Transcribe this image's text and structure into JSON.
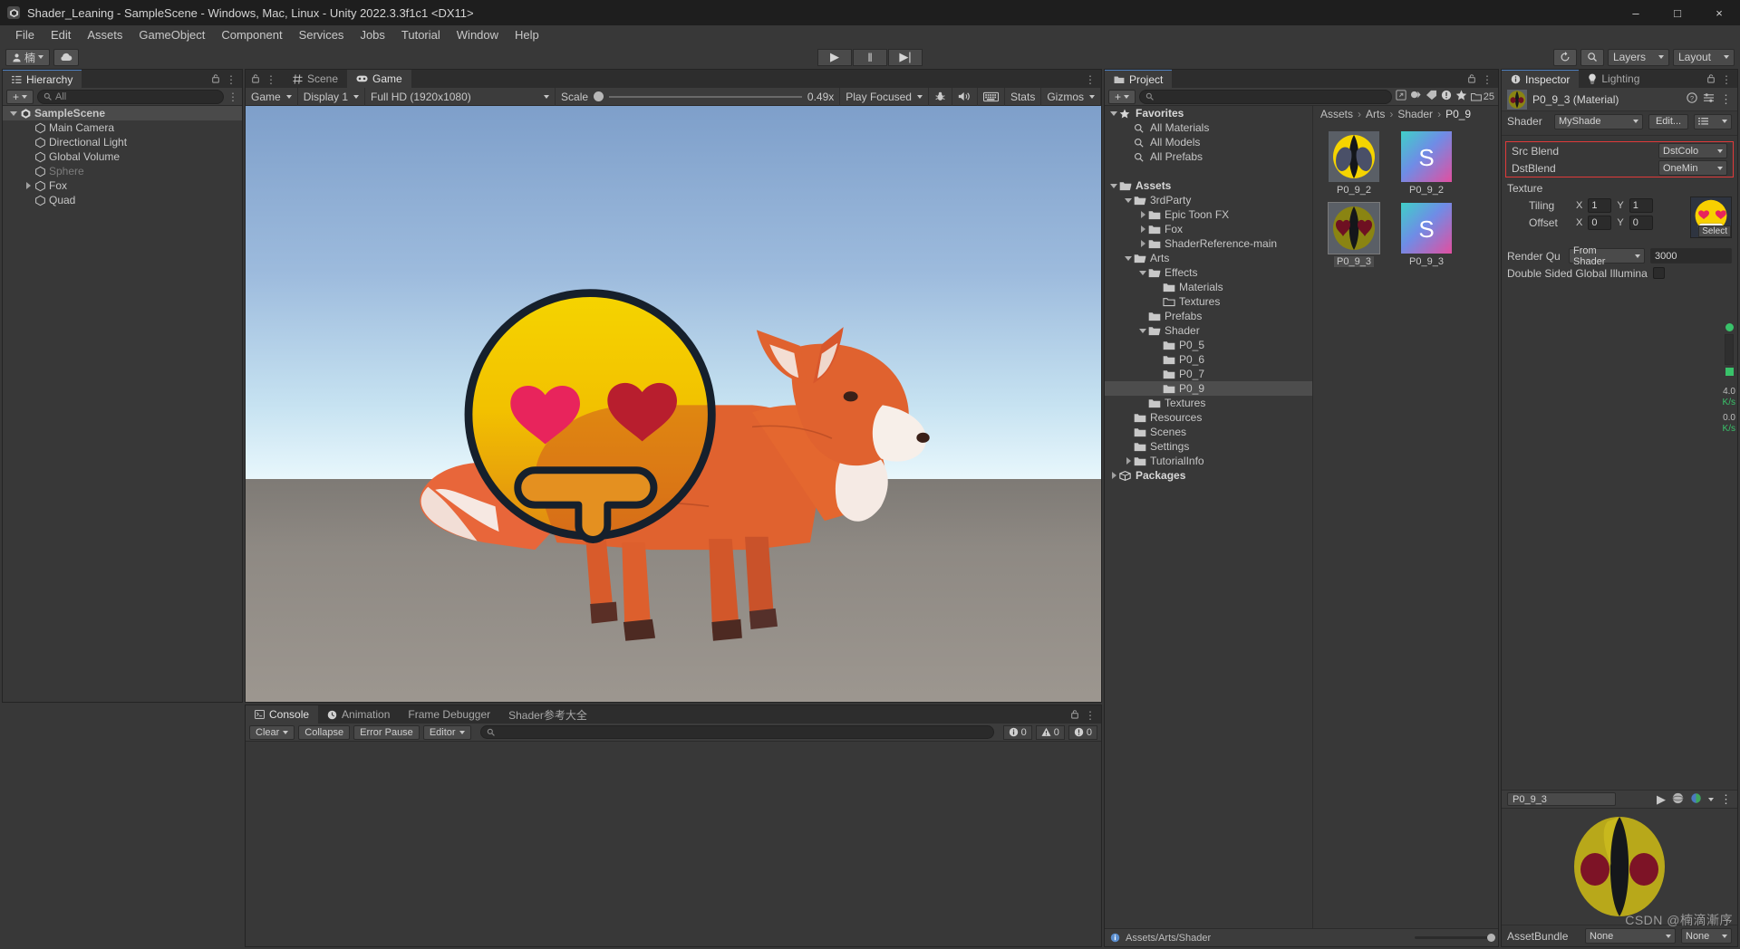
{
  "window": {
    "title": "Shader_Leaning - SampleScene - Windows, Mac, Linux - Unity 2022.3.3f1c1 <DX11>",
    "minimize": "–",
    "maximize": "□",
    "close": "×"
  },
  "menu": {
    "items": [
      "File",
      "Edit",
      "Assets",
      "GameObject",
      "Component",
      "Services",
      "Jobs",
      "Tutorial",
      "Window",
      "Help"
    ]
  },
  "toolbar": {
    "account_label": "楠",
    "cloud_icon": "cloud-icon",
    "play": "▶",
    "pause": "‖",
    "step": "▶|",
    "undo_icon": "history-icon",
    "search_icon": "search-icon",
    "layers": "Layers",
    "layout": "Layout"
  },
  "hierarchy": {
    "tab": "Hierarchy",
    "add_label": "+",
    "search_placeholder": "All",
    "items": [
      {
        "label": "SampleScene",
        "depth": 0,
        "arrow": "down",
        "selected": true,
        "dim": false,
        "icon": "scene-icon"
      },
      {
        "label": "Main Camera",
        "depth": 1,
        "arrow": "none",
        "selected": false,
        "dim": false,
        "icon": "gameobject-icon"
      },
      {
        "label": "Directional Light",
        "depth": 1,
        "arrow": "none",
        "selected": false,
        "dim": false,
        "icon": "gameobject-icon"
      },
      {
        "label": "Global Volume",
        "depth": 1,
        "arrow": "none",
        "selected": false,
        "dim": false,
        "icon": "gameobject-icon"
      },
      {
        "label": "Sphere",
        "depth": 1,
        "arrow": "none",
        "selected": false,
        "dim": true,
        "icon": "gameobject-icon"
      },
      {
        "label": "Fox",
        "depth": 1,
        "arrow": "right",
        "selected": false,
        "dim": false,
        "icon": "gameobject-icon"
      },
      {
        "label": "Quad",
        "depth": 1,
        "arrow": "none",
        "selected": false,
        "dim": false,
        "icon": "gameobject-icon"
      }
    ]
  },
  "gameview": {
    "tabs": [
      {
        "label": "Scene",
        "icon": "grid-icon",
        "active": false
      },
      {
        "label": "Game",
        "icon": "gamepad-icon",
        "active": true
      }
    ],
    "mode": "Game",
    "display": "Display 1",
    "resolution": "Full HD (1920x1080)",
    "scale_label": "Scale",
    "scale_value": "0.49x",
    "play_focus": "Play Focused",
    "mute_icon": "speaker-icon",
    "stats": "Stats",
    "gizmos": "Gizmos",
    "bug_icon": "bug-icon",
    "keyboard_icon": "keyboard-icon"
  },
  "project": {
    "tab": "Project",
    "search_placeholder": "",
    "count_badge": "25",
    "breadcrumb": [
      "Assets",
      "Arts",
      "Shader",
      "P0_9"
    ],
    "tree": [
      {
        "label": "Favorites",
        "depth": 0,
        "arrow": "down",
        "icon": "star",
        "bold": true
      },
      {
        "label": "All Materials",
        "depth": 1,
        "arrow": "none",
        "icon": "search",
        "bold": false
      },
      {
        "label": "All Models",
        "depth": 1,
        "arrow": "none",
        "icon": "search",
        "bold": false
      },
      {
        "label": "All Prefabs",
        "depth": 1,
        "arrow": "none",
        "icon": "search",
        "bold": false
      },
      {
        "label": "",
        "depth": 0,
        "arrow": "none",
        "icon": "none",
        "bold": false
      },
      {
        "label": "Assets",
        "depth": 0,
        "arrow": "down",
        "icon": "folder-open",
        "bold": true
      },
      {
        "label": "3rdParty",
        "depth": 1,
        "arrow": "down",
        "icon": "folder-open",
        "bold": false
      },
      {
        "label": "Epic Toon FX",
        "depth": 2,
        "arrow": "right",
        "icon": "folder",
        "bold": false
      },
      {
        "label": "Fox",
        "depth": 2,
        "arrow": "right",
        "icon": "folder",
        "bold": false
      },
      {
        "label": "ShaderReference-main",
        "depth": 2,
        "arrow": "right",
        "icon": "folder",
        "bold": false
      },
      {
        "label": "Arts",
        "depth": 1,
        "arrow": "down",
        "icon": "folder-open",
        "bold": false
      },
      {
        "label": "Effects",
        "depth": 2,
        "arrow": "down",
        "icon": "folder-open",
        "bold": false
      },
      {
        "label": "Materials",
        "depth": 3,
        "arrow": "none",
        "icon": "folder",
        "bold": false
      },
      {
        "label": "Textures",
        "depth": 3,
        "arrow": "none",
        "icon": "folder-empty",
        "bold": false
      },
      {
        "label": "Prefabs",
        "depth": 2,
        "arrow": "none",
        "icon": "folder",
        "bold": false
      },
      {
        "label": "Shader",
        "depth": 2,
        "arrow": "down",
        "icon": "folder-open",
        "bold": false
      },
      {
        "label": "P0_5",
        "depth": 3,
        "arrow": "none",
        "icon": "folder",
        "bold": false
      },
      {
        "label": "P0_6",
        "depth": 3,
        "arrow": "none",
        "icon": "folder",
        "bold": false
      },
      {
        "label": "P0_7",
        "depth": 3,
        "arrow": "none",
        "icon": "folder",
        "bold": false
      },
      {
        "label": "P0_9",
        "depth": 3,
        "arrow": "none",
        "icon": "folder",
        "bold": false,
        "selected": true
      },
      {
        "label": "Textures",
        "depth": 2,
        "arrow": "none",
        "icon": "folder",
        "bold": false
      },
      {
        "label": "Resources",
        "depth": 1,
        "arrow": "none",
        "icon": "folder",
        "bold": false
      },
      {
        "label": "Scenes",
        "depth": 1,
        "arrow": "none",
        "icon": "folder",
        "bold": false
      },
      {
        "label": "Settings",
        "depth": 1,
        "arrow": "none",
        "icon": "folder",
        "bold": false
      },
      {
        "label": "TutorialInfo",
        "depth": 1,
        "arrow": "right",
        "icon": "folder",
        "bold": false
      },
      {
        "label": "Packages",
        "depth": 0,
        "arrow": "right",
        "icon": "package",
        "bold": true
      }
    ],
    "assets": [
      {
        "label": "P0_9_2",
        "kind": "texture-eye-yellow",
        "selected": false
      },
      {
        "label": "P0_9_2",
        "kind": "shader",
        "selected": false
      },
      {
        "label": "P0_9_3",
        "kind": "texture-eye-heart",
        "selected": true
      },
      {
        "label": "P0_9_3",
        "kind": "shader",
        "selected": false
      }
    ],
    "footer_path": "Assets/Arts/Shader"
  },
  "inspector": {
    "tabs": [
      {
        "label": "Inspector",
        "icon": "info-icon",
        "active": true
      },
      {
        "label": "Lighting",
        "icon": "bulb-icon",
        "active": false
      }
    ],
    "asset_title": "P0_9_3 (Material)",
    "shader_label": "Shader",
    "shader_value": "MyShade",
    "edit_button": "Edit...",
    "properties": [
      {
        "label": "Src Blend",
        "value": "DstColo",
        "type": "enum",
        "highlight": true
      },
      {
        "label": "DstBlend",
        "value": "OneMin",
        "type": "enum",
        "highlight": true
      }
    ],
    "texture_label": "Texture",
    "texture_select": "Select",
    "tiling_label": "Tiling",
    "tiling_x": "1",
    "tiling_y": "1",
    "offset_label": "Offset",
    "offset_x": "0",
    "offset_y": "0",
    "render_queue_label": "Render Qu",
    "render_queue_mode": "From Shader",
    "render_queue_value": "3000",
    "double_sided_label": "Double Sided Global Illumina",
    "axis_labels": [
      "4.0",
      "0.0"
    ],
    "axis_units": [
      "K/s",
      "K/s"
    ],
    "preview_name": "P0_9_3",
    "assetbundle_label": "AssetBundle",
    "assetbundle_value": "None",
    "assetbundle_variant": "None"
  },
  "console": {
    "tabs": [
      {
        "label": "Console",
        "icon": "console-icon",
        "active": true
      },
      {
        "label": "Animation",
        "icon": "clock-icon",
        "active": false
      },
      {
        "label": "Frame Debugger",
        "icon": "none",
        "active": false
      },
      {
        "label": "Shader参考大全",
        "icon": "none",
        "active": false
      }
    ],
    "clear": "Clear",
    "collapse": "Collapse",
    "error_pause": "Error Pause",
    "editor": "Editor",
    "counts": {
      "log": "0",
      "warn": "0",
      "error": "0"
    }
  },
  "watermark": "CSDN @楠滴漸序",
  "colors": {
    "accent": "#4d7fbf",
    "highlight": "#e03a3a",
    "panel": "#383838",
    "bar": "#3c3c3c"
  }
}
